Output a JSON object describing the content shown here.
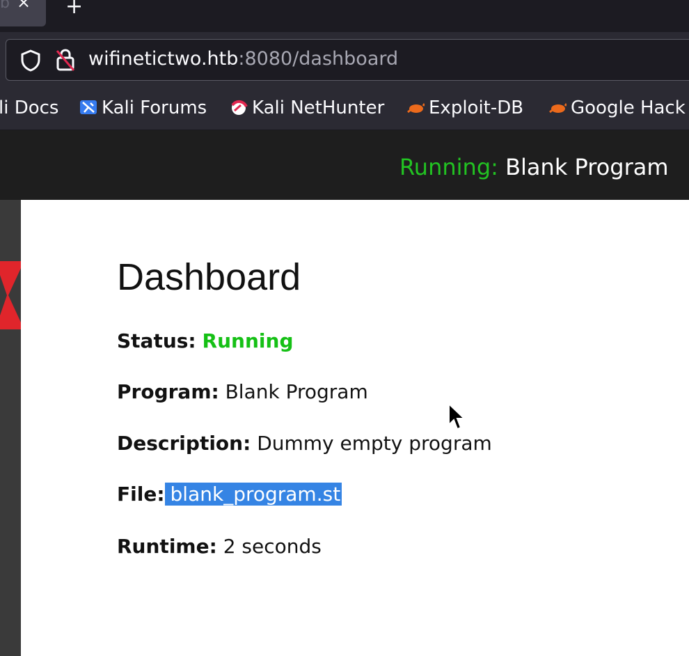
{
  "browser": {
    "tab": {
      "title": "b",
      "close": "×"
    },
    "new_tab": "+",
    "url": {
      "host": "wifinetictwo.htb",
      "rest": ":8080/dashboard"
    },
    "bookmarks": [
      "li Docs",
      "Kali Forums",
      "Kali NetHunter",
      "Exploit-DB",
      "Google Hack"
    ]
  },
  "appbar": {
    "running_label": "Running:",
    "running_program": " Blank Program"
  },
  "dashboard": {
    "title": "Dashboard",
    "status_label": "Status:",
    "status_value": "Running",
    "program_label": "Program:",
    "program_value": "Blank Program",
    "description_label": "Description:",
    "description_value": "Dummy empty program",
    "file_label": "File:",
    "file_value": "blank_program.st",
    "runtime_label": "Runtime:",
    "runtime_value": "2 seconds"
  },
  "colors": {
    "running_green": "#22c322",
    "selection_blue": "#3584e4"
  }
}
